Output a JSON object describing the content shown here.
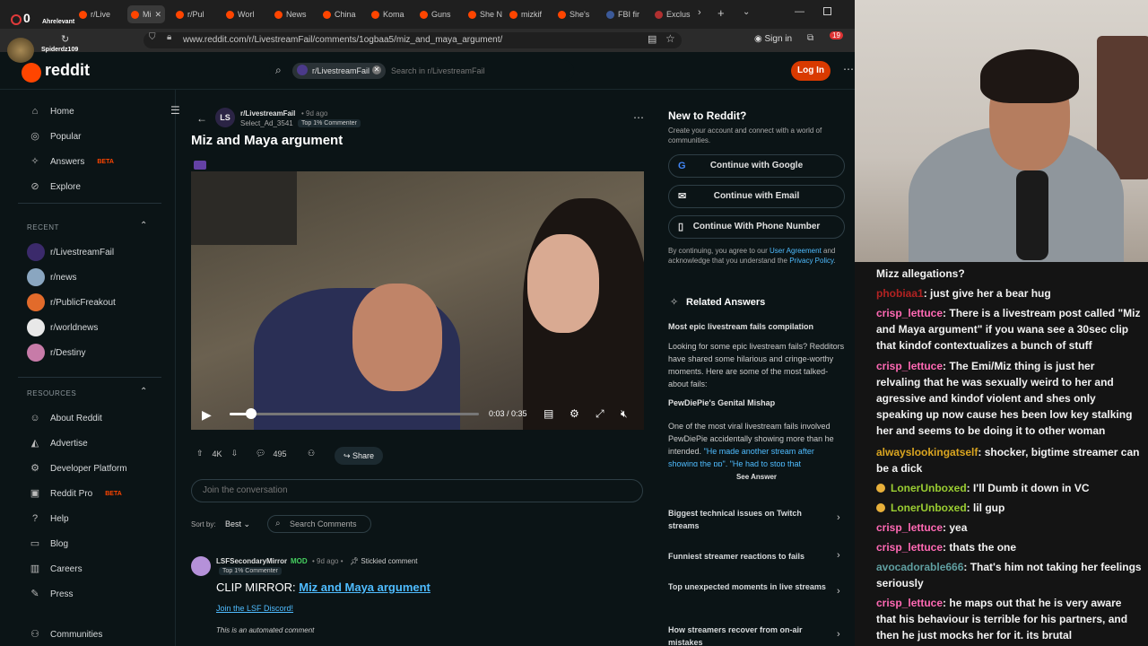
{
  "browser": {
    "tabs": [
      "r/Live",
      "Mi",
      "r/Pul",
      "Worl",
      "News",
      "China",
      "Koma",
      "Guns",
      "She N",
      "mizkif",
      "She's",
      "FBI fir",
      "Exclus"
    ],
    "url": "www.reddit.com/r/LivestreamFail/comments/1ogbaa5/miz_and_maya_argument/",
    "sign_in": "Sign in",
    "badge_count": "19"
  },
  "overlay": {
    "alert_count": "0",
    "alert_name": "Ahrelevant",
    "sub_name": "Spiderdz109"
  },
  "header": {
    "logo": "reddit",
    "search_chip": "r/LivestreamFail",
    "search_placeholder": "Search in r/LivestreamFail",
    "login": "Log In"
  },
  "sidebar": {
    "nav": [
      {
        "label": "Home",
        "icon": "home-icon"
      },
      {
        "label": "Popular",
        "icon": "popular-icon"
      },
      {
        "label": "Answers",
        "icon": "answers-icon",
        "badge": "BETA"
      },
      {
        "label": "Explore",
        "icon": "explore-icon"
      }
    ],
    "recent_title": "RECENT",
    "recent": [
      "r/LivestreamFail",
      "r/news",
      "r/PublicFreakout",
      "r/worldnews",
      "r/Destiny"
    ],
    "resources_title": "RESOURCES",
    "resources": [
      {
        "label": "About Reddit"
      },
      {
        "label": "Advertise"
      },
      {
        "label": "Developer Platform"
      },
      {
        "label": "Reddit Pro",
        "badge": "BETA"
      },
      {
        "label": "Help"
      },
      {
        "label": "Blog"
      },
      {
        "label": "Careers"
      },
      {
        "label": "Press"
      }
    ],
    "communities": "Communities"
  },
  "post": {
    "sub_avatar": "LS",
    "subreddit": "r/LivestreamFail",
    "time": "• 9d ago",
    "author": "Select_Ad_3541",
    "author_badge": "Top 1% Commenter",
    "title": "Miz and Maya argument",
    "video_time": "0:03 / 0:35",
    "video_progress": 0.086,
    "votes": "4K",
    "comments": "495",
    "share": "Share",
    "comment_placeholder": "Join the conversation",
    "sort_label": "Sort by:",
    "sort_value": "Best",
    "search_comments": "Search Comments"
  },
  "comment": {
    "author": "LSFSecondaryMirror",
    "mod": "MOD",
    "time": "• 9d ago •",
    "sticky": "Stickied comment",
    "badge": "Top 1% Commenter",
    "clip_prefix": "CLIP MIRROR:",
    "clip_link": "Miz and Maya argument",
    "discord": "Join the LSF Discord!",
    "automated": "This is an automated comment"
  },
  "rail": {
    "title": "New to Reddit?",
    "desc": "Create your account and connect with a world of communities.",
    "google": "Continue with Google",
    "email": "Continue with Email",
    "phone": "Continue With Phone Number",
    "terms_prefix": "By continuing, you agree to our",
    "user_agreement": "User Agreement",
    "terms_mid": "and acknowledge that you understand the",
    "privacy": "Privacy Policy",
    "related_title": "Related Answers",
    "q1": "Most epic livestream fails compilation",
    "q1_body": "Looking for some epic livestream fails? Redditors have shared some hilarious and cringe-worthy moments. Here are some of the most talked-about fails:",
    "h1": "PewDiePie's Genital Mishap",
    "h1_body": "One of the most viral livestream fails involved PewDiePie accidentally showing more than he intended.",
    "h1_link": "\"He made another stream after showing the pp\", \"He had to stop that",
    "see_answer": "See Answer",
    "questions": [
      "Biggest technical issues on Twitch streams",
      "Funniest streamer reactions to fails",
      "Top unexpected moments in live streams",
      "How streamers recover from on-air mistakes"
    ]
  },
  "chat": [
    {
      "user": "",
      "text": "Mizz allegations?",
      "color": "#f2f2f2"
    },
    {
      "user": "phobiaa1",
      "text": ": just give her a bear hug",
      "color": "#b22222"
    },
    {
      "user": "crisp_lettuce",
      "text": ": There is a livestream post called \"Miz and Maya argument\" if you wana see a 30sec clip that kindof contextualizes a bunch of stuff",
      "color": "#ff69b4"
    },
    {
      "user": "crisp_lettuce",
      "text": ": The Emi/Miz thing is just her relvaling that he was sexually weird to her and agressive and kindof violent and shes only speaking up now cause hes been low key stalking her and seems to be doing it to other woman",
      "color": "#ff69b4"
    },
    {
      "user": "alwayslookingatself",
      "text": ": shocker, bigtime streamer can be a dick",
      "color": "#daa520"
    },
    {
      "user": "LonerUnboxed",
      "text": ": I'll Dumb it down in VC",
      "color": "#9acd32",
      "badge": true
    },
    {
      "user": "LonerUnboxed",
      "text": ": lil gup",
      "color": "#9acd32",
      "badge": true
    },
    {
      "user": "crisp_lettuce",
      "text": ": yea",
      "color": "#ff69b4"
    },
    {
      "user": "crisp_lettuce",
      "text": ": thats the one",
      "color": "#ff69b4"
    },
    {
      "user": "avocadorable666",
      "text": ": That's him not taking her feelings seriously",
      "color": "#5f9ea0"
    },
    {
      "user": "crisp_lettuce",
      "text": ": he maps out that he is very aware that his behaviour is terrible for his partners, and then he just mocks her for it. its brutal",
      "color": "#ff69b4"
    }
  ]
}
